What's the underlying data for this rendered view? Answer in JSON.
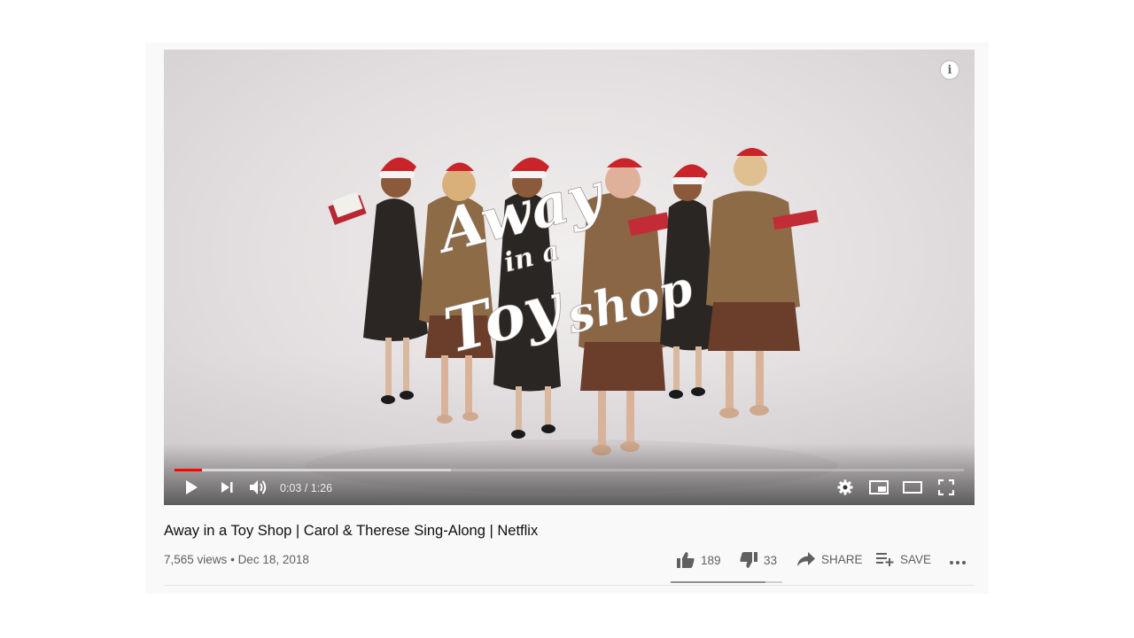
{
  "video": {
    "title": "Away in a Toy Shop | Carol & Therese Sing-Along | Netflix",
    "overlay_title": {
      "line1": "Away",
      "line2": "in a",
      "line3": "Toy",
      "line4": "shop"
    },
    "info_icon": "info-icon",
    "info_glyph": "i"
  },
  "player": {
    "time_display": "0:03 / 1:26",
    "current_time": "0:03",
    "duration": "1:26",
    "played_fraction": 0.035,
    "buffered_fraction": 0.35,
    "icons": {
      "play": "play-icon",
      "next": "skip-next-icon",
      "volume": "volume-icon",
      "settings": "gear-icon",
      "miniplayer": "miniplayer-icon",
      "theater": "theater-mode-icon",
      "fullscreen": "fullscreen-icon"
    }
  },
  "meta": {
    "views": "7,565 views",
    "separator": "•",
    "date": "Dec 18, 2018"
  },
  "actions": {
    "likes": "189",
    "dislikes": "33",
    "share_label": "SHARE",
    "save_label": "SAVE",
    "like_ratio": 0.85
  },
  "colors": {
    "progress_played": "#ff0000",
    "text_primary": "#0f0f0f",
    "text_secondary": "#606060"
  }
}
